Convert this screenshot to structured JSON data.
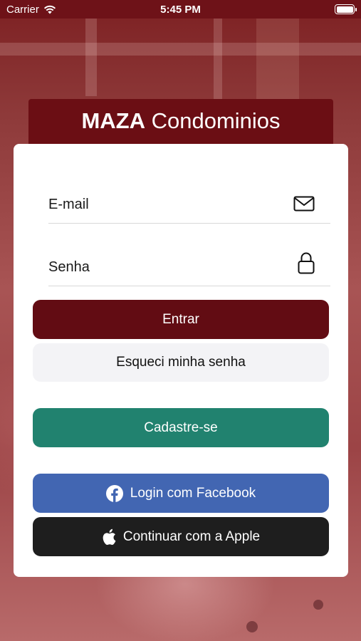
{
  "status_bar": {
    "carrier": "Carrier",
    "time": "5:45 PM"
  },
  "header": {
    "title_bold": "MAZA",
    "title_rest": "Condominios"
  },
  "form": {
    "email_label": "E-mail",
    "password_label": "Senha",
    "login_button": "Entrar",
    "forgot_button": "Esqueci minha senha",
    "signup_button": "Cadastre-se",
    "facebook_button": "Login com Facebook",
    "apple_button": "Continuar com a Apple"
  },
  "icons": {
    "email": "envelope-icon",
    "password": "lock-icon",
    "facebook": "facebook-icon",
    "apple": "apple-icon"
  },
  "colors": {
    "primary": "#620c13",
    "signup": "#21826f",
    "facebook": "#4266b2",
    "apple": "#1e1e1e",
    "forgot_bg": "#f3f3f6"
  }
}
